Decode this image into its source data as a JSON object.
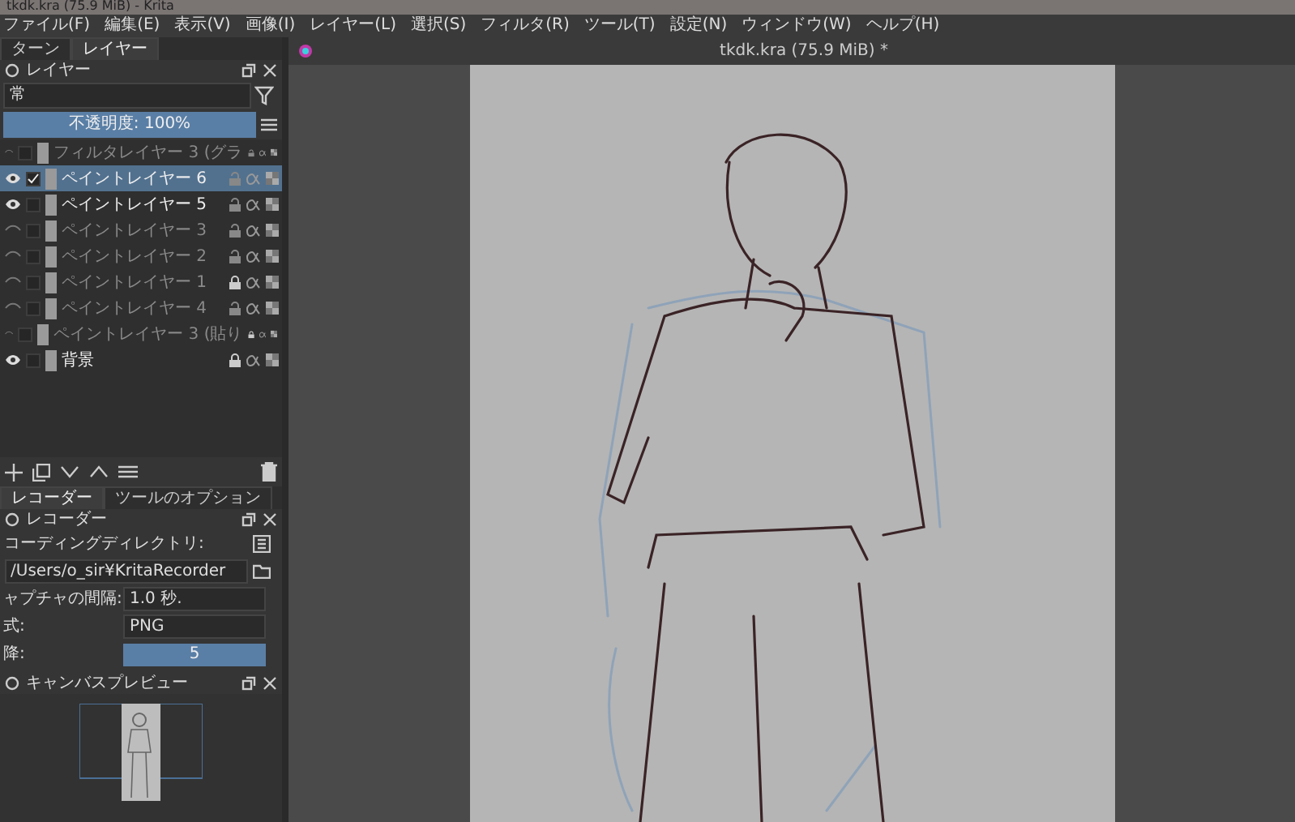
{
  "window": {
    "title": "tkdk.kra (75.9 MiB) - Krita"
  },
  "menu": [
    "ファイル(F)",
    "編集(E)",
    "表示(V)",
    "画像(I)",
    "レイヤー(L)",
    "選択(S)",
    "フィルタ(R)",
    "ツール(T)",
    "設定(N)",
    "ウィンドウ(W)",
    "ヘルプ(H)"
  ],
  "left_tabs": [
    {
      "label": "ターン",
      "selected": false
    },
    {
      "label": "レイヤー",
      "selected": true
    }
  ],
  "layers_docker": {
    "title": "レイヤー",
    "blend_mode": "常",
    "opacity": {
      "text": "不透明度: 100%",
      "level": 1
    },
    "layers": [
      {
        "name": "フィルタレイヤー 3 (グラ",
        "visible": false,
        "checked": false,
        "locked": false,
        "selected": false
      },
      {
        "name": "ペイントレイヤー 6",
        "visible": true,
        "checked": true,
        "locked": false,
        "selected": true
      },
      {
        "name": "ペイントレイヤー 5",
        "visible": true,
        "checked": false,
        "locked": false,
        "selected": false
      },
      {
        "name": "ペイントレイヤー 3",
        "visible": false,
        "checked": false,
        "locked": false,
        "selected": false
      },
      {
        "name": "ペイントレイヤー 2",
        "visible": false,
        "checked": false,
        "locked": false,
        "selected": false
      },
      {
        "name": "ペイントレイヤー 1",
        "visible": false,
        "checked": false,
        "locked": true,
        "selected": false
      },
      {
        "name": "ペイントレイヤー 4",
        "visible": false,
        "checked": false,
        "locked": false,
        "selected": false
      },
      {
        "name": "ペイントレイヤー 3 (貼り",
        "visible": false,
        "checked": false,
        "locked": true,
        "selected": false
      },
      {
        "name": "背景",
        "visible": true,
        "checked": false,
        "locked": true,
        "selected": false
      }
    ]
  },
  "bottom_tabs": [
    {
      "label": "レコーダー",
      "selected": true
    },
    {
      "label": "ツールのオプション",
      "selected": false
    }
  ],
  "recorder": {
    "title": "レコーダー",
    "dir_label": "コーディングディレクトリ:",
    "dir": "/Users/o_sir¥KritaRecorder",
    "fields": [
      {
        "label": "ャプチャの間隔:",
        "kind": "spin",
        "value": "1.0 秒."
      },
      {
        "label": "式:",
        "kind": "select",
        "value": "PNG"
      },
      {
        "label": "降:",
        "kind": "slider",
        "value": "5",
        "level": 1
      }
    ]
  },
  "preview": {
    "title": "キャンバスプレビュー"
  },
  "document": {
    "title": "tkdk.kra (75.9 MiB) *"
  }
}
